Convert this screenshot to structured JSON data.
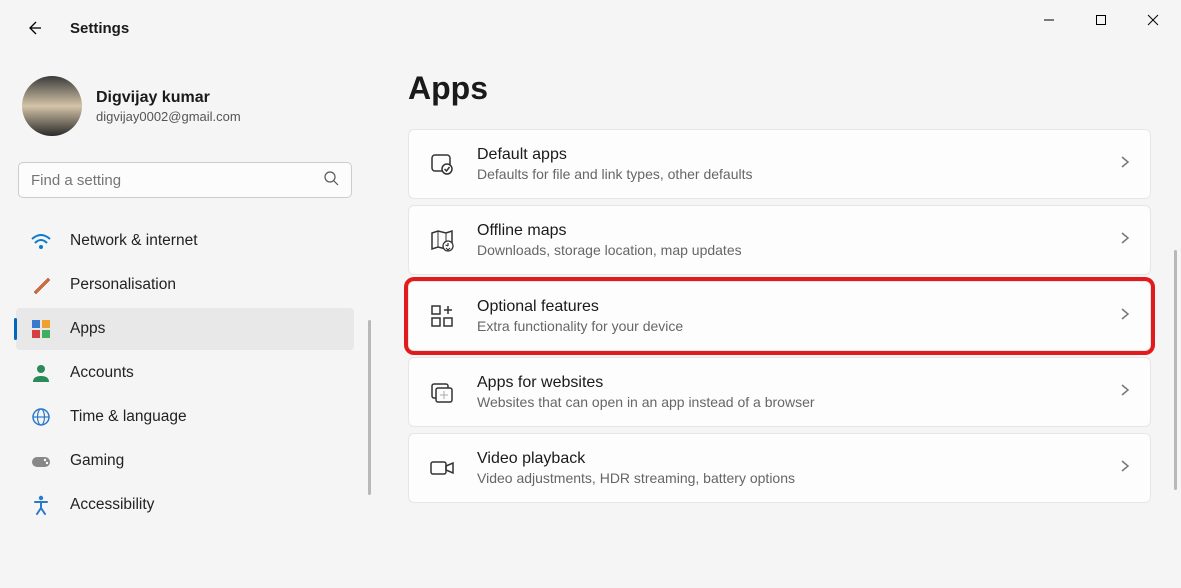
{
  "app": {
    "title": "Settings"
  },
  "profile": {
    "name": "Digvijay kumar",
    "email": "digvijay0002@gmail.com"
  },
  "search": {
    "placeholder": "Find a setting"
  },
  "nav": {
    "items": [
      {
        "label": "Network & internet",
        "icon": "wifi-icon"
      },
      {
        "label": "Personalisation",
        "icon": "brush-icon"
      },
      {
        "label": "Apps",
        "icon": "apps-icon",
        "active": true
      },
      {
        "label": "Accounts",
        "icon": "person-icon"
      },
      {
        "label": "Time & language",
        "icon": "globe-clock-icon"
      },
      {
        "label": "Gaming",
        "icon": "gamepad-icon"
      },
      {
        "label": "Accessibility",
        "icon": "accessibility-icon"
      }
    ]
  },
  "page": {
    "title": "Apps",
    "cards": [
      {
        "icon": "default-apps-icon",
        "title": "Default apps",
        "sub": "Defaults for file and link types, other defaults"
      },
      {
        "icon": "map-icon",
        "title": "Offline maps",
        "sub": "Downloads, storage location, map updates"
      },
      {
        "icon": "optional-features-icon",
        "title": "Optional features",
        "sub": "Extra functionality for your device",
        "highlight": true
      },
      {
        "icon": "apps-websites-icon",
        "title": "Apps for websites",
        "sub": "Websites that can open in an app instead of a browser"
      },
      {
        "icon": "video-icon",
        "title": "Video playback",
        "sub": "Video adjustments, HDR streaming, battery options"
      }
    ]
  }
}
